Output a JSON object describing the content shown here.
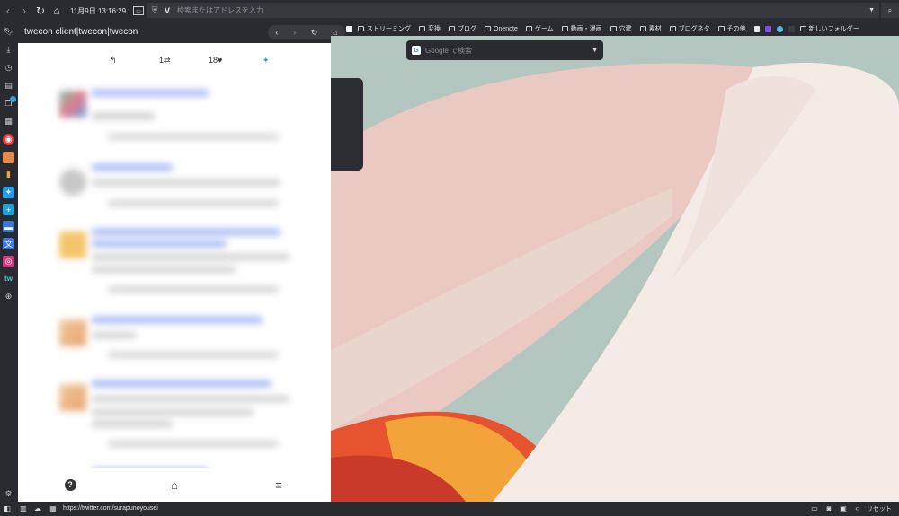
{
  "toolbar": {
    "clock": "11月9日  13:16:29",
    "address_placeholder": "検索またはアドレスを入力"
  },
  "bookmarks": [
    {
      "label": "ストリーミング",
      "kind": "folder"
    },
    {
      "label": "変換",
      "kind": "folder"
    },
    {
      "label": "ブログ",
      "kind": "folder"
    },
    {
      "label": "Onenote",
      "kind": "folder"
    },
    {
      "label": "ゲーム",
      "kind": "folder"
    },
    {
      "label": "動画・漫画",
      "kind": "folder"
    },
    {
      "label": "穴建",
      "kind": "folder"
    },
    {
      "label": "素材",
      "kind": "folder"
    },
    {
      "label": "ブログネタ",
      "kind": "folder"
    },
    {
      "label": "その他",
      "kind": "folder"
    },
    {
      "label": "新しいフォルダー",
      "kind": "folder"
    }
  ],
  "panel": {
    "title": "twecon client|twecon|twecon",
    "first_tweet": {
      "retweets": "1",
      "likes": "18"
    }
  },
  "sidebar": {
    "badge": "1",
    "tw_label": "tw"
  },
  "start_page": {
    "search_placeholder": "Google で検索"
  },
  "statusbar": {
    "url": "https://twitter.com/surapunoyousei",
    "reset_label": "リセット"
  },
  "colors": {
    "chrome_bg": "#2a2b31",
    "panel_bg": "#ffffff",
    "twitter_blue": "#1d9bf0",
    "link_blue": "#6f8ff0"
  }
}
